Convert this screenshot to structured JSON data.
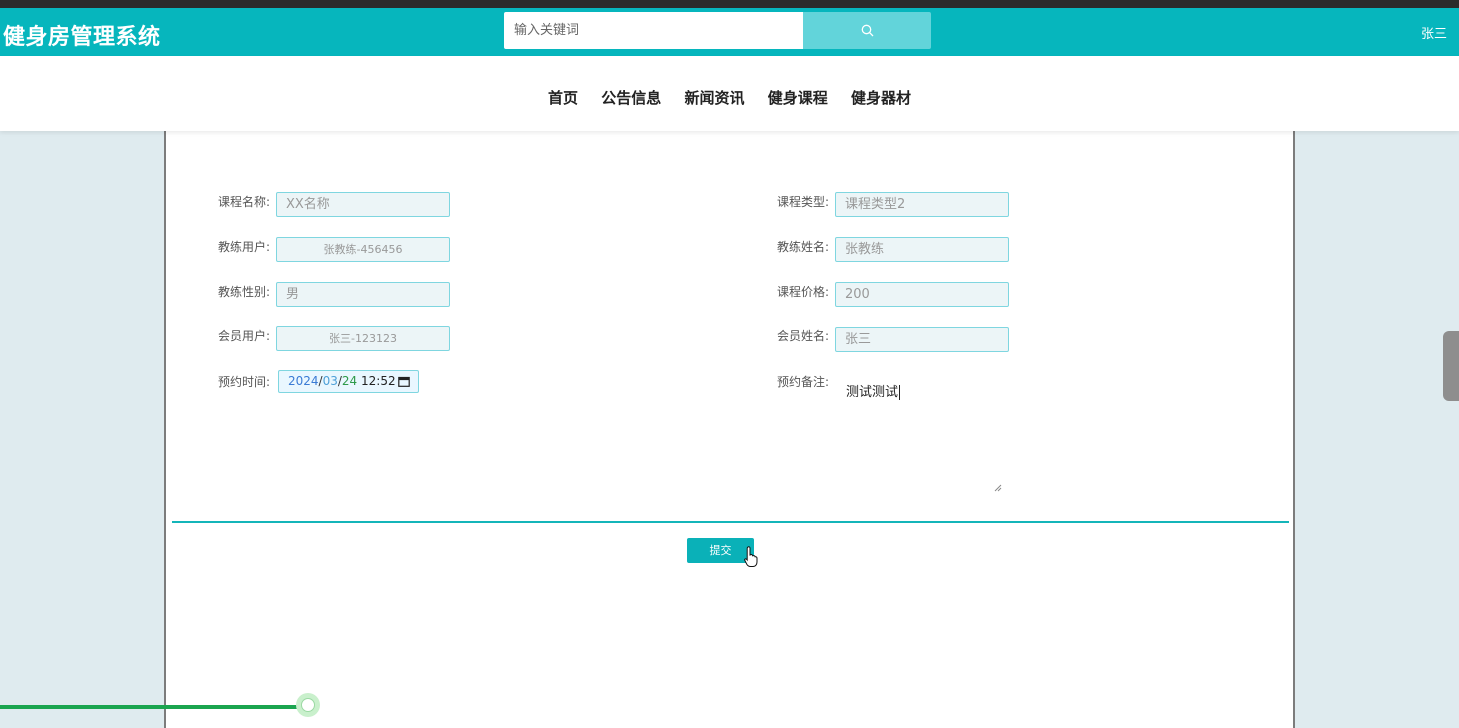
{
  "app": {
    "title": "健身房管理系统"
  },
  "header": {
    "search_placeholder": "输入关键词",
    "user": "张三"
  },
  "nav": {
    "items": [
      "首页",
      "公告信息",
      "新闻资讯",
      "健身课程",
      "健身器材"
    ]
  },
  "form": {
    "course_name": {
      "label": "课程名称:",
      "value": "XX名称"
    },
    "course_type": {
      "label": "课程类型:",
      "value": "课程类型2"
    },
    "coach_user": {
      "label": "教练用户:",
      "value": "张教练-456456"
    },
    "coach_name": {
      "label": "教练姓名:",
      "value": "张教练"
    },
    "coach_gender": {
      "label": "教练性别:",
      "value": "男"
    },
    "course_price": {
      "label": "课程价格:",
      "value": "200"
    },
    "member_user": {
      "label": "会员用户:",
      "value": "张三-123123"
    },
    "member_name": {
      "label": "会员姓名:",
      "value": "张三"
    },
    "booking_time": {
      "label": "预约时间:",
      "year": "2024",
      "sep1": "/",
      "month": "03",
      "sep2": "/",
      "day": "24",
      "time": "12:52"
    },
    "remark": {
      "label": "预约备注:",
      "value": "测试测试"
    },
    "submit_label": "提交"
  },
  "colors": {
    "header_bg": "#06b6bd",
    "search_btn_bg": "#62d4da",
    "accent": "#0ab1b8",
    "page_bg": "#dfebef"
  },
  "icons": {
    "search": "search-icon",
    "calendar": "calendar-icon",
    "resize": "resize-handle-icon",
    "cursor": "hand-pointer-icon"
  }
}
